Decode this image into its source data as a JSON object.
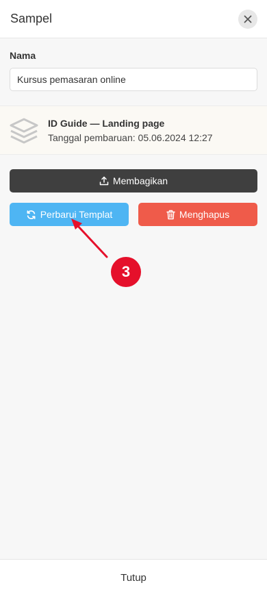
{
  "header": {
    "title": "Sampel",
    "close_icon": "close-icon"
  },
  "form": {
    "name_label": "Nama",
    "name_value": "Kursus pemasaran online"
  },
  "card": {
    "icon": "layers-icon",
    "title": "ID Guide — Landing page",
    "subtitle": "Tanggal pembaruan: 05.06.2024 12:27"
  },
  "actions": {
    "share_label": "Membagikan",
    "update_label": "Perbarui Templat",
    "delete_label": "Menghapus"
  },
  "annotation": {
    "step": "3",
    "color": "#e5102b"
  },
  "footer": {
    "close_label": "Tutup"
  },
  "colors": {
    "share_bg": "#3f3f3f",
    "update_bg": "#4eb5f3",
    "delete_bg": "#ef5b4a"
  }
}
